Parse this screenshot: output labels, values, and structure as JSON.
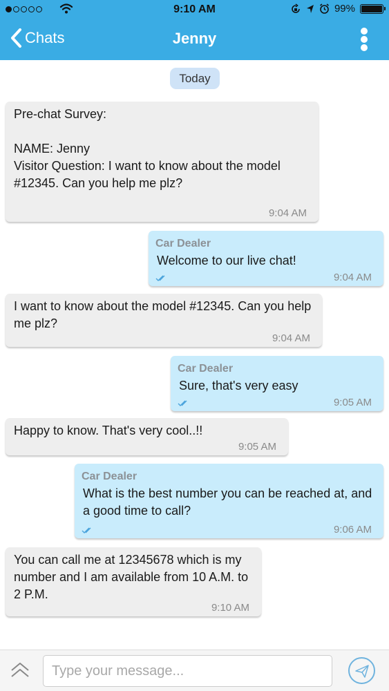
{
  "status_bar": {
    "time": "9:10 AM",
    "battery": "99%",
    "battery_level": 0.99,
    "signal_strength": 1,
    "icons": [
      "signal-dots-icon",
      "wifi-icon",
      "orientation-lock-icon",
      "location-arrow-icon",
      "alarm-clock-icon",
      "battery-icon"
    ]
  },
  "header": {
    "back_label": "Chats",
    "title": "Jenny",
    "back_icon": "chevron-left-icon",
    "more_icon": "more-vertical-icon"
  },
  "date_separator": "Today",
  "messages": [
    {
      "direction": "in",
      "text": "Pre-chat Survey:\n\nNAME: Jenny\nVisitor Question: I want to know about the model #12345. Can you help me plz?",
      "time": "9:04 AM"
    },
    {
      "direction": "out",
      "sender": "Car Dealer",
      "text": "Welcome to our live chat!",
      "time": "9:04 AM",
      "status_icon": "double-check-icon"
    },
    {
      "direction": "in",
      "text": "I want to know about the model #12345. Can you help me plz?",
      "time": "9:04 AM"
    },
    {
      "direction": "out",
      "sender": "Car Dealer",
      "text": "Sure, that's very easy",
      "time": "9:05 AM",
      "status_icon": "double-check-icon"
    },
    {
      "direction": "in",
      "text": "Happy to know. That's very cool..!!",
      "time": "9:05 AM"
    },
    {
      "direction": "out",
      "sender": "Car Dealer",
      "text": "What is the best number you can be reached at, and a good time to call?",
      "time": "9:06 AM",
      "status_icon": "double-check-icon"
    },
    {
      "direction": "in",
      "text": "You can call me at 12345678 which is my number and I am available from 10 A.M. to 2 P.M.",
      "time": "9:10 AM"
    }
  ],
  "composer": {
    "placeholder": "Type your message...",
    "value": "",
    "expand_icon": "chevron-up-double-icon",
    "send_icon": "paper-plane-icon"
  },
  "colors": {
    "accent": "#3aace4",
    "incoming_bubble": "#eeeeee",
    "outgoing_bubble": "#c9ecfc",
    "date_badge": "#cfe3f7"
  }
}
